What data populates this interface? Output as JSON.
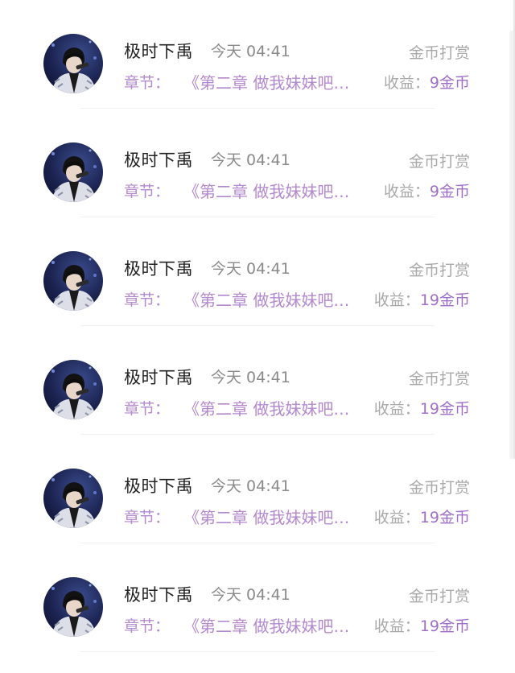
{
  "records": [
    {
      "user": "极时下禹",
      "time": "今天 04:41",
      "reward_type": "金币打赏",
      "chapter_label": "章节：",
      "chapter_title": "《第二章 做我妹妹吧…",
      "income_label": "收益：",
      "income_value": "9金币"
    },
    {
      "user": "极时下禹",
      "time": "今天 04:41",
      "reward_type": "金币打赏",
      "chapter_label": "章节：",
      "chapter_title": "《第二章 做我妹妹吧…",
      "income_label": "收益：",
      "income_value": "9金币"
    },
    {
      "user": "极时下禹",
      "time": "今天 04:41",
      "reward_type": "金币打赏",
      "chapter_label": "章节：",
      "chapter_title": "《第二章 做我妹妹吧…",
      "income_label": "收益：",
      "income_value": "19金币"
    },
    {
      "user": "极时下禹",
      "time": "今天 04:41",
      "reward_type": "金币打赏",
      "chapter_label": "章节：",
      "chapter_title": "《第二章 做我妹妹吧…",
      "income_label": "收益：",
      "income_value": "19金币"
    },
    {
      "user": "极时下禹",
      "time": "今天 04:41",
      "reward_type": "金币打赏",
      "chapter_label": "章节：",
      "chapter_title": "《第二章 做我妹妹吧…",
      "income_label": "收益：",
      "income_value": "19金币"
    },
    {
      "user": "极时下禹",
      "time": "今天 04:41",
      "reward_type": "金币打赏",
      "chapter_label": "章节：",
      "chapter_title": "《第二章 做我妹妹吧…",
      "income_label": "收益：",
      "income_value": "19金币"
    }
  ],
  "colors": {
    "accent_purple": "#b488cf",
    "income_value": "#a070c8",
    "muted_text": "#a9a9a9",
    "name_text": "#222222"
  },
  "icons": {
    "avatar": "user-avatar-singer-photo"
  }
}
